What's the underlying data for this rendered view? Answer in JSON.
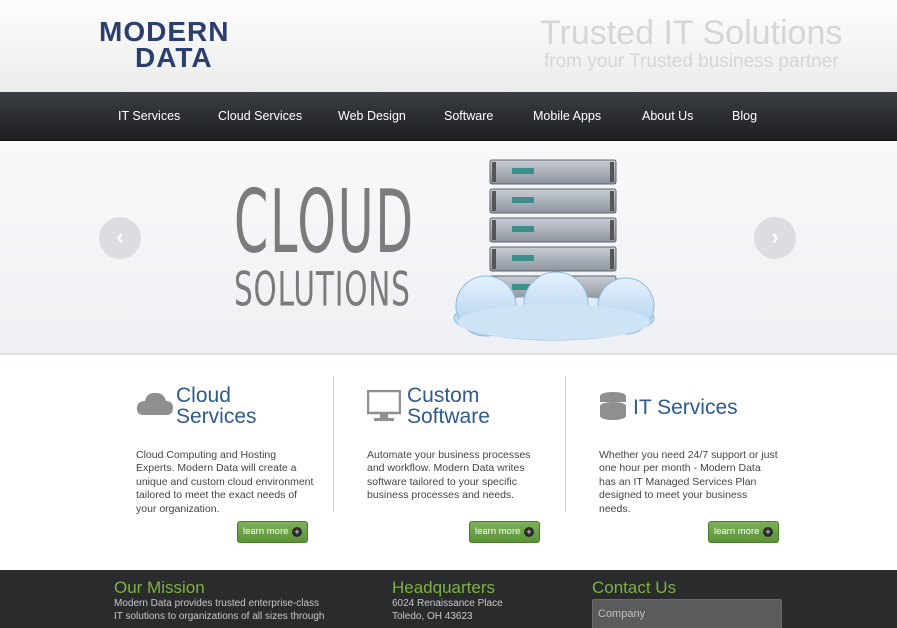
{
  "header": {
    "logo_line1": "MODERN",
    "logo_line2": "DATA",
    "tagline_main": "Trusted IT Solutions",
    "tagline_sub": "from your Trusted business partner"
  },
  "nav": {
    "items": [
      {
        "label": "IT Services"
      },
      {
        "label": "Cloud Services"
      },
      {
        "label": "Web Design"
      },
      {
        "label": "Software"
      },
      {
        "label": "Mobile Apps"
      },
      {
        "label": "About Us"
      },
      {
        "label": "Blog"
      }
    ]
  },
  "hero": {
    "title_line1": "CLOUD",
    "title_line2": "SOLUTIONS",
    "prev_icon": "chevron-left-icon",
    "next_icon": "chevron-right-icon"
  },
  "services": [
    {
      "icon": "cloud-icon",
      "title_line1": "Cloud",
      "title_line2": "Services",
      "body": "Cloud Computing and Hosting Experts. Modern Data will create a unique and custom cloud environment tailored to meet the exact needs of your organization.",
      "button": "learn more"
    },
    {
      "icon": "monitor-icon",
      "title_line1": "Custom",
      "title_line2": "Software",
      "body": "Automate your business processes and workflow. Modern Data writes software tailored to your specific business processes and needs.",
      "button": "learn more"
    },
    {
      "icon": "database-icon",
      "title_line1": "IT Services",
      "title_line2": "",
      "body": "Whether you need 24/7 support or just one hour per month - Modern Data has an IT Managed Services Plan designed to meet your business needs.",
      "button": "learn more"
    }
  ],
  "footer": {
    "mission_title": "Our Mission",
    "mission_line1": "Modern Data provides trusted enterprise-class",
    "mission_line2": "IT solutions to organizations of all sizes through",
    "hq_title": "Headquarters",
    "hq_line1": "6024 Renaissance Place",
    "hq_line2": "Toledo, OH 43623",
    "contact_title": "Contact Us",
    "company_placeholder": "Company"
  },
  "colors": {
    "brand_blue": "#2b3f6e",
    "heading_blue": "#2e5a8c",
    "accent_green": "#7cb342",
    "nav_bg": "#2a2c30"
  }
}
